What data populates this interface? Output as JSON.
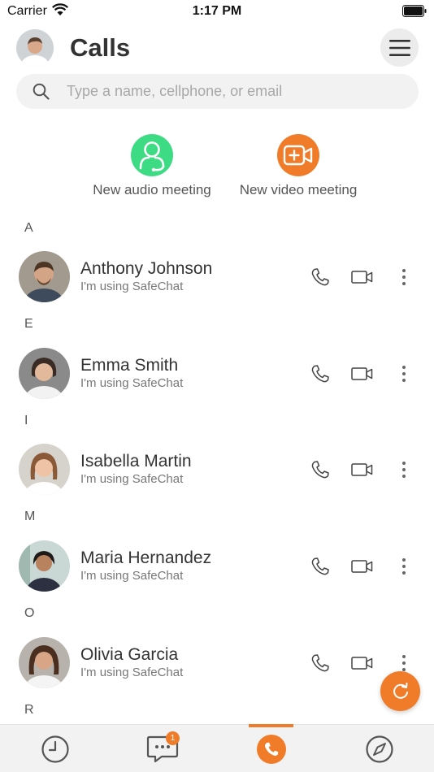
{
  "status_bar": {
    "carrier": "Carrier",
    "time": "1:17 PM"
  },
  "header": {
    "title": "Calls"
  },
  "search": {
    "placeholder": "Type a name, cellphone, or email"
  },
  "meetings": {
    "audio_label": "New audio meeting",
    "video_label": "New video meeting"
  },
  "contact_status": "I'm using SafeChat",
  "sections": [
    {
      "letter": "A",
      "contact": {
        "name": "Anthony Johnson",
        "status": "I'm using SafeChat"
      }
    },
    {
      "letter": "E",
      "contact": {
        "name": "Emma Smith",
        "status": "I'm using SafeChat"
      }
    },
    {
      "letter": "I",
      "contact": {
        "name": "Isabella Martin",
        "status": "I'm using SafeChat"
      }
    },
    {
      "letter": "M",
      "contact": {
        "name": "Maria Hernandez",
        "status": "I'm using SafeChat"
      }
    },
    {
      "letter": "O",
      "contact": {
        "name": "Olivia Garcia",
        "status": "I'm using SafeChat"
      }
    },
    {
      "letter": "R"
    }
  ],
  "tab_bar": {
    "tabs": [
      "history-icon",
      "chat-icon",
      "phone-icon",
      "compass-icon"
    ],
    "active": "phone-icon",
    "chat_badge": "1"
  },
  "colors": {
    "accent": "#f07c2a",
    "audio_green": "#3ddc84",
    "video_orange": "#f07c2a"
  }
}
